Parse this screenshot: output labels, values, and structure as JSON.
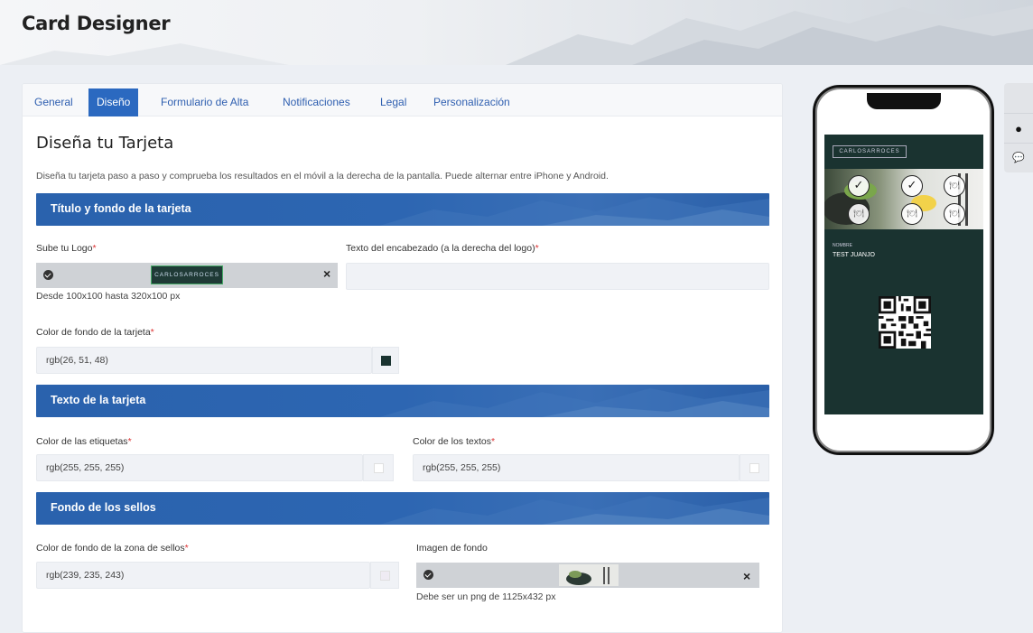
{
  "app": {
    "title": "Card Designer"
  },
  "tabs": [
    {
      "label": "General"
    },
    {
      "label": "Diseño"
    },
    {
      "label": "Formulario de Alta"
    },
    {
      "label": "Notificaciones"
    },
    {
      "label": "Legal"
    },
    {
      "label": "Personalización"
    }
  ],
  "page": {
    "title": "Diseña tu Tarjeta",
    "description": "Diseña tu tarjeta paso a paso y comprueba los resultados en el móvil a la derecha de la pantalla. Puede alternar entre iPhone y Android."
  },
  "sections": {
    "title_bg": {
      "heading": "Título y fondo de la tarjeta",
      "logo_label": "Sube tu Logo",
      "logo_text": "CARLOSARROCES",
      "logo_hint": "Desde 100x100 hasta 320x100 px",
      "header_text_label": "Texto del encabezado (a la derecha del logo)",
      "header_text_value": "",
      "bg_color_label": "Color de fondo de la tarjeta",
      "bg_color_value": "rgb(26, 51, 48)"
    },
    "card_text": {
      "heading": "Texto de la tarjeta",
      "labels_color_label": "Color de las etiquetas",
      "labels_color_value": "rgb(255, 255, 255)",
      "texts_color_label": "Color de los textos",
      "texts_color_value": "rgb(255, 255, 255)"
    },
    "stamps_bg": {
      "heading": "Fondo de los sellos",
      "zone_color_label": "Color de fondo de la zona de sellos",
      "zone_color_value": "rgb(239, 235, 243)",
      "bg_image_label": "Imagen de fondo",
      "bg_image_hint": "Debe ser un png de 1125x432 px"
    }
  },
  "required_mark": "*",
  "remove_glyph": "×",
  "preview": {
    "logo_text": "CARLOSARROCES",
    "name_label": "NOMBRE",
    "name_value": "TEST JUANJO",
    "stamps": [
      "✓",
      "✓",
      "🍽",
      "🍽",
      "🍽",
      "🍽"
    ]
  },
  "side_buttons": [
    {
      "icon": "apple-icon",
      "glyph": "",
      "accent": "#111111"
    },
    {
      "icon": "android-icon",
      "glyph": "●",
      "accent": "#111111"
    },
    {
      "icon": "chat-icon",
      "glyph": "💬",
      "accent": "#111111"
    }
  ],
  "colors": {
    "accent": "#2b69c0",
    "card_bg": "#1a3330",
    "required": "#dd3333"
  }
}
